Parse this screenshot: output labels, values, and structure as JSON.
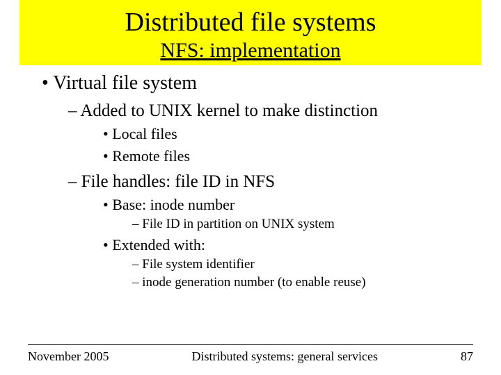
{
  "title": "Distributed file systems",
  "subtitle": "NFS: implementation",
  "bullets": {
    "l1_1": "Virtual file system",
    "l2_1": "Added to UNIX kernel to make distinction",
    "l3_1": "Local files",
    "l3_2": "Remote files",
    "l2_2": "File handles: file ID in NFS",
    "l3_3": "Base: inode number",
    "l4_1": "File ID in partition on UNIX system",
    "l3_4": "Extended with:",
    "l4_2": "File system identifier",
    "l4_3": "inode generation number (to enable reuse)"
  },
  "footer": {
    "date": "November 2005",
    "center": "Distributed systems: general services",
    "page": "87"
  }
}
